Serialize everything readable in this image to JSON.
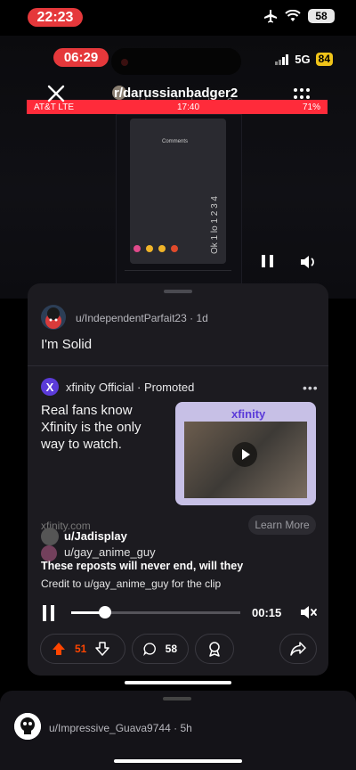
{
  "status_bar": {
    "time": "22:23",
    "battery": "58"
  },
  "recording": {
    "time": "06:29",
    "network": "5G",
    "battery": "84",
    "subreddit": "r/darussianbadger2",
    "subreddit_ghost": "r/darussianbadger2",
    "inner_bar": {
      "carrier": "AT&T  LTE",
      "time": "17:40",
      "battery": "71%"
    },
    "inner_comments_label": "Comments",
    "vertical_text": "Ok 1 lo 1 2 3 4"
  },
  "comment": {
    "author": "u/IndependentParfait23",
    "age": "1d",
    "text": "I'm Solid"
  },
  "promo": {
    "logo_letter": "X",
    "brand": "xfinity",
    "official": "Official",
    "promoted": "Promoted",
    "text": "Real fans know Xfinity is the only way to watch.",
    "card_brand": "xfinity",
    "domain": "xfinity.com",
    "cta": "Learn More"
  },
  "overlay": {
    "user": "u/Jadisplay",
    "credited_user": "u/gay_anime_guy",
    "line1": "These reposts will never end, will they",
    "line2": "Credit to u/gay_anime_guy for the clip"
  },
  "player": {
    "time": "00:15",
    "progress": 0.2
  },
  "actions": {
    "upvotes": "51",
    "comments": "58"
  },
  "next_comment": {
    "author": "u/Impressive_Guava9744",
    "age": "5h"
  },
  "colors": {
    "upvote": "#ff4500",
    "accent_red": "#e5383b",
    "xfinity": "#5b3bd9"
  }
}
